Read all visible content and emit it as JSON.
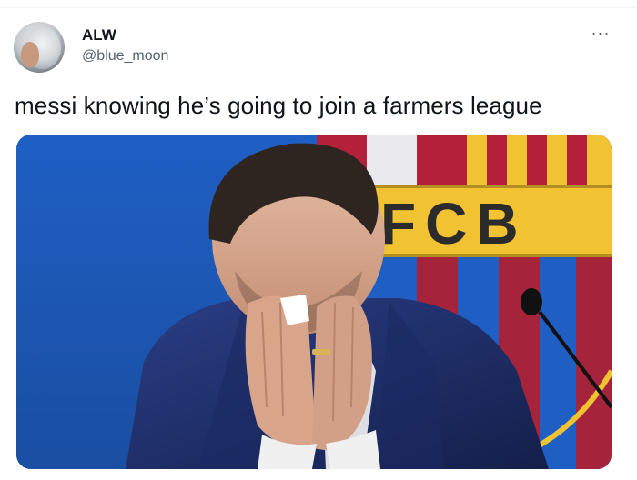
{
  "tweet": {
    "display_name": "ALW",
    "handle": "@blue_moon",
    "more_label": "···",
    "text": "messi knowing he’s going to join a farmers league"
  },
  "media": {
    "crest_text": "FCB",
    "alt": "Man in a navy suit covering his face with his hands in front of an FC Barcelona crest backdrop"
  },
  "colors": {
    "blue": "#1f5fc4",
    "crest_red": "#b4203a",
    "crest_gold": "#f1c232",
    "suit": "#1e2f6b",
    "handle_gray": "#536471"
  }
}
